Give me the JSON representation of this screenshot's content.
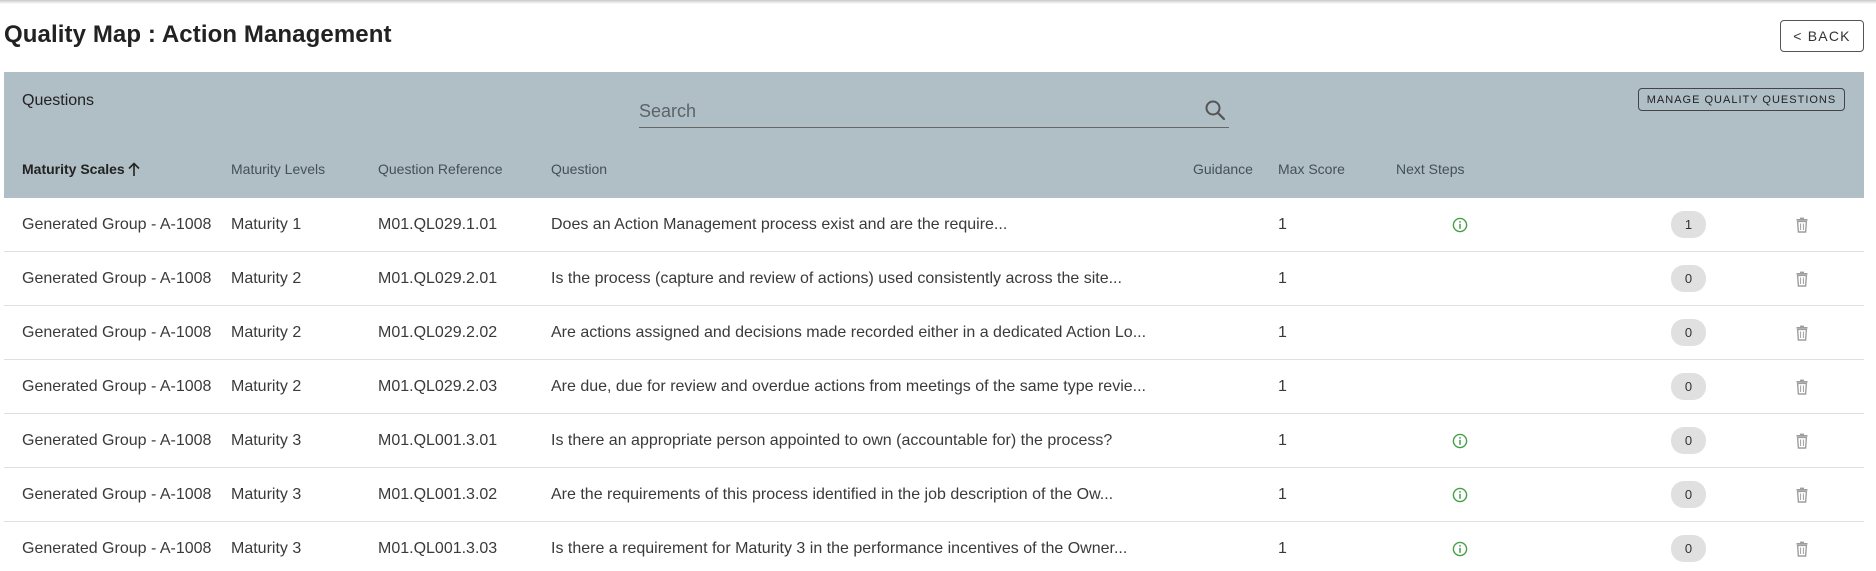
{
  "page": {
    "title": "Quality Map : Action Management",
    "back_label": "< BACK"
  },
  "panel": {
    "label": "Questions",
    "search_placeholder": "Search",
    "search_value": "",
    "manage_label": "MANAGE QUALITY QUESTIONS"
  },
  "table": {
    "sort_column": "maturity_scales",
    "sort_direction": "ascending",
    "columns": {
      "maturity_scales": "Maturity Scales",
      "maturity_levels": "Maturity Levels",
      "question_reference": "Question Reference",
      "question": "Question",
      "guidance": "Guidance",
      "max_score": "Max Score",
      "next_steps": "Next Steps"
    },
    "rows": [
      {
        "scale": "Generated Group - A-1008",
        "level": "Maturity 1",
        "ref": "M01.QL029.1.01",
        "question": "Does an Action Management process exist and are the require...",
        "guidance": true,
        "max_score": "1",
        "next_steps": "1"
      },
      {
        "scale": "Generated Group - A-1008",
        "level": "Maturity 2",
        "ref": "M01.QL029.2.01",
        "question": "Is the process (capture and review of actions) used consistently across the site...",
        "guidance": false,
        "max_score": "1",
        "next_steps": "0"
      },
      {
        "scale": "Generated Group - A-1008",
        "level": "Maturity 2",
        "ref": "M01.QL029.2.02",
        "question": "Are actions assigned and decisions made recorded either in a dedicated Action Lo...",
        "guidance": false,
        "max_score": "1",
        "next_steps": "0"
      },
      {
        "scale": "Generated Group - A-1008",
        "level": "Maturity 2",
        "ref": "M01.QL029.2.03",
        "question": "Are due, due for review and overdue actions from meetings of the same type revie...",
        "guidance": false,
        "max_score": "1",
        "next_steps": "0"
      },
      {
        "scale": "Generated Group - A-1008",
        "level": "Maturity 3",
        "ref": "M01.QL001.3.01",
        "question": "Is there an appropriate person appointed to own (accountable for) the process?",
        "guidance": true,
        "max_score": "1",
        "next_steps": "0"
      },
      {
        "scale": "Generated Group - A-1008",
        "level": "Maturity 3",
        "ref": "M01.QL001.3.02",
        "question": "Are the requirements of this process identified in the job description of the Ow...",
        "guidance": true,
        "max_score": "1",
        "next_steps": "0"
      },
      {
        "scale": "Generated Group - A-1008",
        "level": "Maturity 3",
        "ref": "M01.QL001.3.03",
        "question": "Is there a requirement for Maturity 3 in the performance incentives of the Owner...",
        "guidance": true,
        "max_score": "1",
        "next_steps": "0"
      }
    ]
  },
  "colors": {
    "header_background": "#b0bec5",
    "guidance_icon": "#43a047",
    "chip_background": "#e0e0e0",
    "delete_icon": "#9e9e9e"
  },
  "icons": {
    "search": "search-icon",
    "sort": "arrow-up-icon",
    "guidance": "info-circle-icon",
    "delete": "trash-icon"
  }
}
